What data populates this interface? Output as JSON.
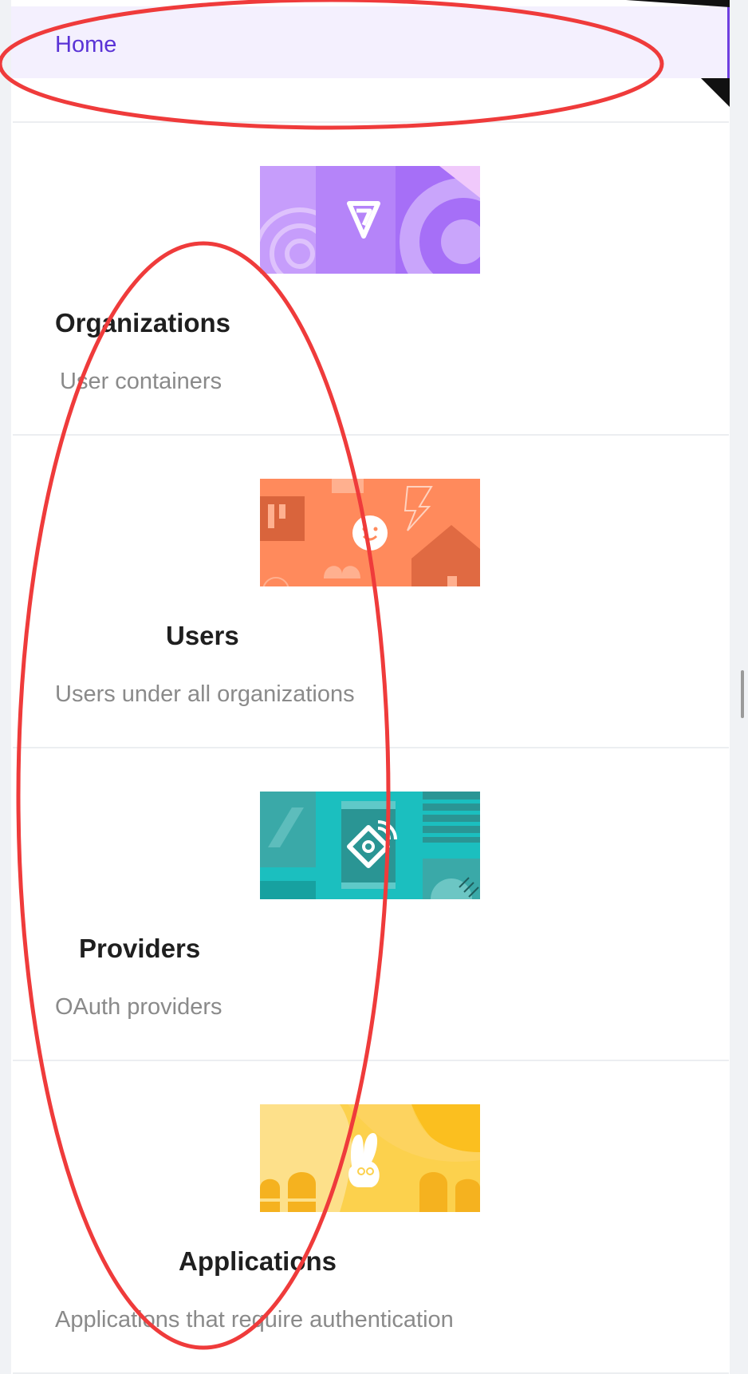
{
  "menu": {
    "home_label": "Home"
  },
  "cards": [
    {
      "title": "Organizations",
      "description": "User containers",
      "image_icon": "vite-logo-icon"
    },
    {
      "title": "Users",
      "description": "Users under all organizations",
      "image_icon": "smiley-house-icon"
    },
    {
      "title": "Providers",
      "description": "OAuth providers",
      "image_icon": "provider-key-icon"
    },
    {
      "title": "Applications",
      "description": "Applications that require authentication",
      "image_icon": "rabbit-icon"
    }
  ],
  "colors": {
    "accent": "#6f3fe0",
    "home_bg": "#f4f0fe",
    "annotation": "#ef3b3b",
    "organizations_bg": "#a66ff7",
    "users_bg": "#ff8a5c",
    "providers_bg": "#1bbfbf",
    "applications_bg": "#fcd14d"
  }
}
